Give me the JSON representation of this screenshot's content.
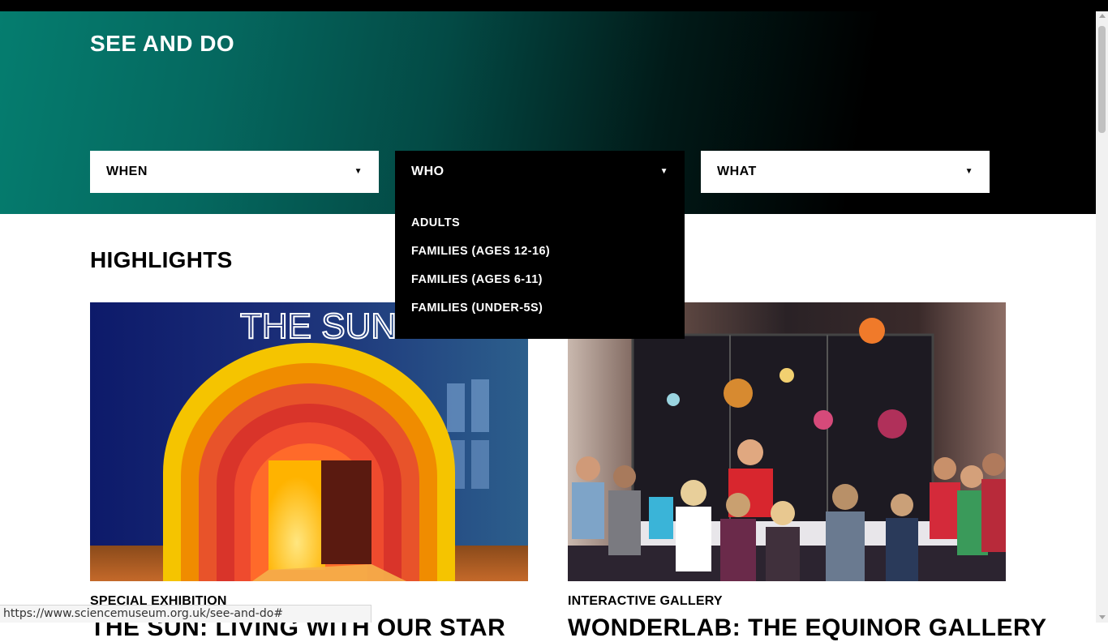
{
  "hero": {
    "title": "SEE AND DO"
  },
  "filters": {
    "when": {
      "label": "WHEN",
      "icon": "caret-down-icon"
    },
    "who": {
      "label": "WHO",
      "icon": "caret-down-icon",
      "expanded": true,
      "options": [
        "ADULTS",
        "FAMILIES (AGES 12-16)",
        "FAMILIES (AGES 6-11)",
        "FAMILIES (UNDER-5S)"
      ]
    },
    "what": {
      "label": "WHAT",
      "icon": "caret-down-icon"
    },
    "caret_glyph": "▼"
  },
  "highlights": {
    "title": "HIGHLIGHTS",
    "cards": [
      {
        "image_sign_text": "THE SUN",
        "tag": "SPECIAL EXHIBITION",
        "heading": "THE SUN: LIVING WITH OUR STAR"
      },
      {
        "tag": "INTERACTIVE GALLERY",
        "heading": "WONDERLAB: THE EQUINOR GALLERY"
      }
    ]
  },
  "status_bar": {
    "url": "https://www.sciencemuseum.org.uk/see-and-do#"
  },
  "colors": {
    "hero_teal": "#057d6f",
    "black": "#000000",
    "white": "#ffffff"
  }
}
